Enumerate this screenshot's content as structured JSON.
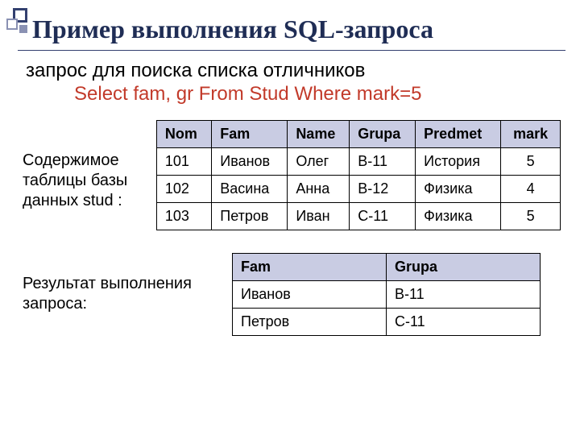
{
  "title": "Пример выполнения SQL-запроса",
  "lead": "запрос для поиска списка отличников",
  "sql": "Select fam, gr  From Stud  Where mark=5",
  "caption1": "Содержимое таблицы базы данных stud :",
  "caption2": "Результат выполнения запроса:",
  "table1": {
    "headers": [
      "Nom",
      "Fam",
      "Name",
      "Grupa",
      "Predmet",
      "mark"
    ],
    "rows": [
      [
        "101",
        "Иванов",
        "Олег",
        "В-11",
        "История",
        "5"
      ],
      [
        "102",
        "Васина",
        "Анна",
        "В-12",
        "Физика",
        "4"
      ],
      [
        "103",
        "Петров",
        "Иван",
        "С-11",
        "Физика",
        "5"
      ]
    ]
  },
  "table2": {
    "headers": [
      "Fam",
      "Grupa"
    ],
    "rows": [
      [
        "Иванов",
        "В-11"
      ],
      [
        "Петров",
        "С-11"
      ]
    ]
  }
}
